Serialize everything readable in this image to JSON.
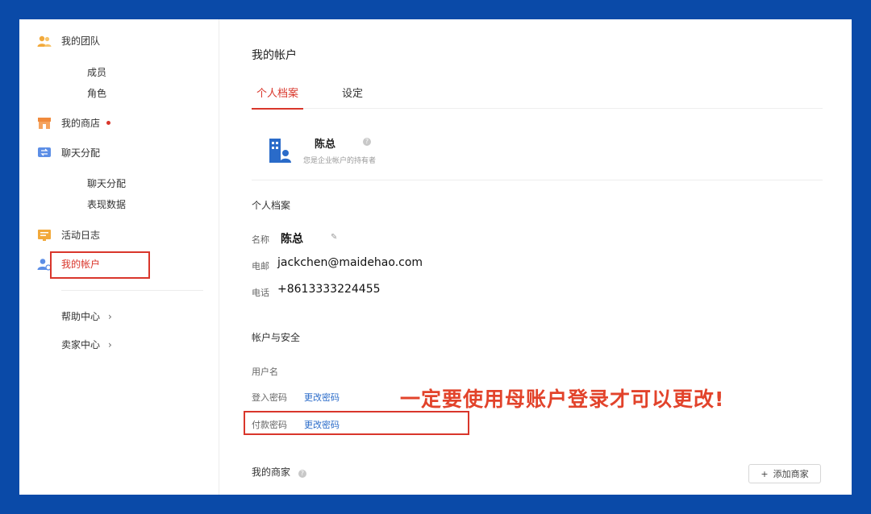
{
  "sidebar": {
    "team": {
      "label": "我的团队",
      "icon": "team-icon",
      "items": [
        "成员",
        "角色"
      ]
    },
    "shop": {
      "label": "我的商店",
      "icon": "shop-icon"
    },
    "chat": {
      "label": "聊天分配",
      "icon": "chat-assign-icon",
      "items": [
        "聊天分配",
        "表现数据"
      ]
    },
    "activity": {
      "label": "活动日志",
      "icon": "activity-log-icon"
    },
    "account": {
      "label": "我的帐户",
      "icon": "account-icon"
    },
    "help": {
      "label": "帮助中心"
    },
    "seller": {
      "label": "卖家中心"
    }
  },
  "main": {
    "title": "我的帐户",
    "tabs": [
      {
        "label": "个人档案",
        "active": true
      },
      {
        "label": "设定",
        "active": false
      }
    ],
    "profile": {
      "name": "陈总",
      "subtitle": "您是企业帐户的持有者"
    },
    "personal": {
      "title": "个人档案",
      "name_label": "名称",
      "name_value": "陈总",
      "email_label": "电邮",
      "email_value": "jackchen@maidehao.com",
      "phone_label": "电话",
      "phone_value": "+8613333224455"
    },
    "security": {
      "title": "帐户与安全",
      "username_label": "用户名",
      "login_pw_label": "登入密码",
      "login_pw_link": "更改密码",
      "pay_pw_label": "付款密码",
      "pay_pw_link": "更改密码"
    },
    "merchants": {
      "title": "我的商家",
      "add_label": "添加商家"
    }
  },
  "annotation": "一定要使用母账户登录才可以更改!",
  "colors": {
    "accent": "#d9362b",
    "link": "#2a6bc9",
    "border": "#0a4aa8",
    "annotation": "#e2432b"
  }
}
